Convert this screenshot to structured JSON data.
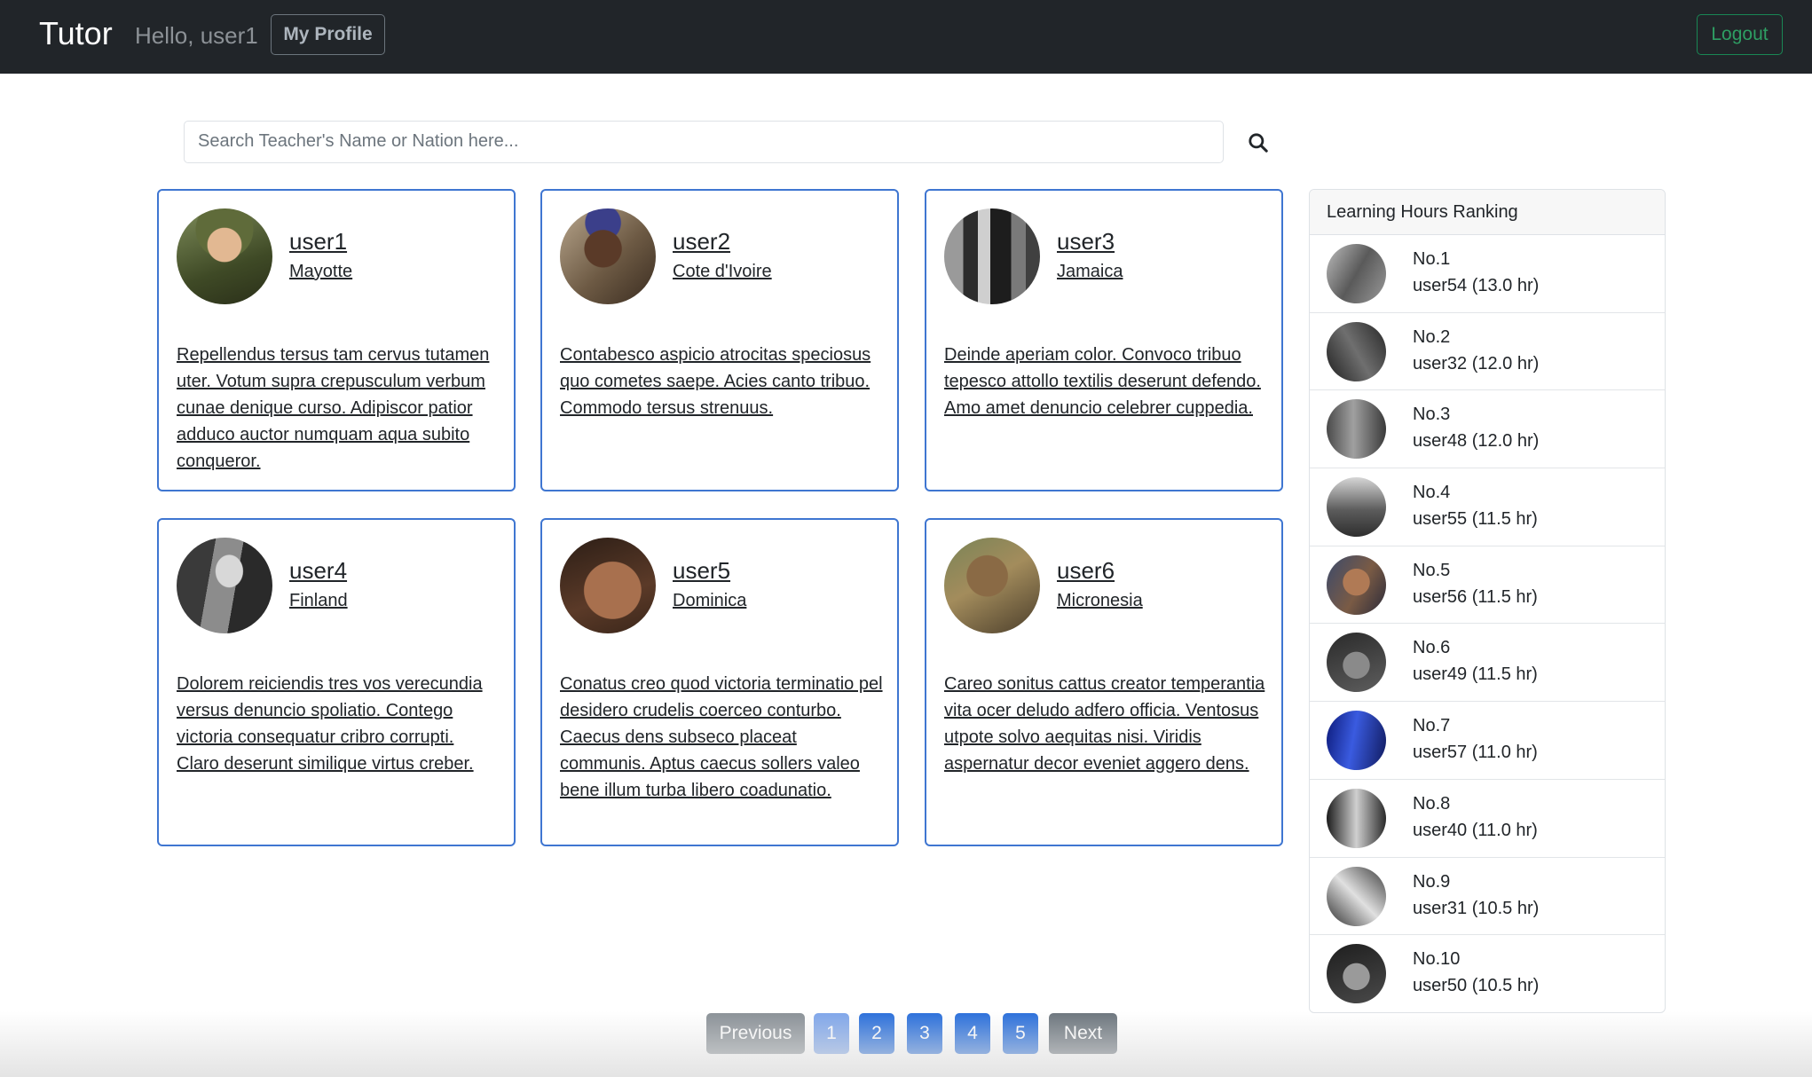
{
  "navbar": {
    "brand": "Tutor",
    "greeting": "Hello, user1",
    "profile_label": "My Profile",
    "logout_label": "Logout"
  },
  "search": {
    "placeholder": "Search Teacher's Name or Nation here..."
  },
  "teachers": [
    {
      "name": "user1",
      "nation": "Mayotte",
      "bio": "Repellendus tersus tam cervus tutamen uter. Votum supra crepusculum verbum cunae denique curso. Adipiscor patior adduco auctor numquam aqua subito conqueror."
    },
    {
      "name": "user2",
      "nation": "Cote d'Ivoire",
      "bio": "Contabesco aspicio atrocitas speciosus quo cometes saepe. Acies canto tribuo. Commodo tersus strenuus."
    },
    {
      "name": "user3",
      "nation": "Jamaica",
      "bio": "Deinde aperiam color. Convoco tribuo tepesco attollo textilis deserunt defendo. Amo amet denuncio celebrer cuppedia."
    },
    {
      "name": "user4",
      "nation": "Finland",
      "bio": "Dolorem reiciendis tres vos verecundia versus denuncio spoliatio. Contego victoria consequatur cribro corrupti. Claro deserunt similique virtus creber."
    },
    {
      "name": "user5",
      "nation": "Dominica",
      "bio": "Conatus creo quod victoria terminatio pel desidero crudelis coerceo conturbo. Caecus dens subseco placeat communis. Aptus caecus sollers valeo bene illum turba libero coadunatio."
    },
    {
      "name": "user6",
      "nation": "Micronesia",
      "bio": "Careo sonitus cattus creator temperantia vita ocer deludo adfero officia. Ventosus utpote solvo aequitas nisi. Viridis aspernatur decor eveniet aggero dens."
    }
  ],
  "ranking": {
    "title": "Learning Hours Ranking",
    "items": [
      {
        "no": "No.1",
        "user": "user54 (13.0 hr)"
      },
      {
        "no": "No.2",
        "user": "user32 (12.0 hr)"
      },
      {
        "no": "No.3",
        "user": "user48 (12.0 hr)"
      },
      {
        "no": "No.4",
        "user": "user55 (11.5 hr)"
      },
      {
        "no": "No.5",
        "user": "user56 (11.5 hr)"
      },
      {
        "no": "No.6",
        "user": "user49 (11.5 hr)"
      },
      {
        "no": "No.7",
        "user": "user57 (11.0 hr)"
      },
      {
        "no": "No.8",
        "user": "user40 (11.0 hr)"
      },
      {
        "no": "No.9",
        "user": "user31 (10.5 hr)"
      },
      {
        "no": "No.10",
        "user": "user50 (10.5 hr)"
      }
    ]
  },
  "pagination": {
    "previous": "Previous",
    "next": "Next",
    "pages": [
      "1",
      "2",
      "3",
      "4",
      "5"
    ],
    "current": "1"
  },
  "colors": {
    "navbar_bg": "#212529",
    "card_border": "#3f76d1",
    "page_button": "#2a6fdb",
    "page_active": "#7fa6ea",
    "logout_green": "#198754"
  }
}
